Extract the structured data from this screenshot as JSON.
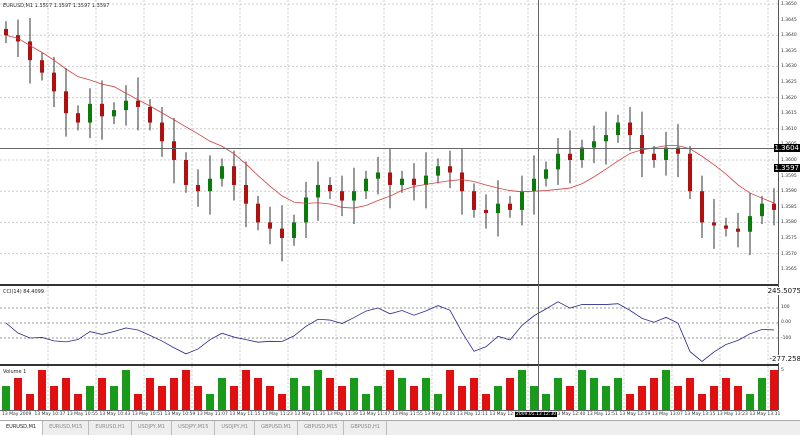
{
  "main": {
    "label": "EURUSD,M1  1.3597 1.3597 1.3597 1.3597",
    "crosshair_price": "1.3604",
    "current_price": "1.3597",
    "price_ticks": [
      "1.3650",
      "1.3645",
      "1.3640",
      "1.3635",
      "1.3630",
      "1.3625",
      "1.3620",
      "1.3615",
      "1.3610",
      "1.3605",
      "1.3600",
      "1.3595",
      "1.3590",
      "1.3585",
      "1.3580",
      "1.3575",
      "1.3570",
      "1.3565"
    ]
  },
  "osc": {
    "label": "CCI(14) 84.4099",
    "ticks": [
      "245.5075",
      "100",
      "0.00",
      "-100",
      "-277.258"
    ]
  },
  "vol": {
    "label": "Volume 1",
    "tick": "5"
  },
  "time": {
    "labels": [
      "13 May 2009",
      "13 May 10:37",
      "13 May 10:55",
      "13 May 10:43",
      "13 May 10:51",
      "13 May 10:59",
      "13 May 11:07",
      "13 May 11:15",
      "13 May 11:23",
      "13 May 11:31",
      "13 May 11:39",
      "13 May 11:47",
      "13 May 11:55",
      "13 May 12:03",
      "13 May 12:11",
      "13 May 12:15",
      "13 May 12:23",
      "13 May 12:40",
      "13 May 12:51",
      "13 May 12:59",
      "13 May 13:07",
      "13 May 13:15",
      "13 May 13:23",
      "13 May 13:31"
    ],
    "crosshair": "2009.05.13 12:30"
  },
  "tabs": [
    "EURUSD,M1",
    "EURUSD,M15",
    "EURUSD,H1",
    "USDJPY,M1",
    "USDJPY,M15",
    "USDJPY,H1",
    "GBPUSD,M1",
    "GBPUSD,M15",
    "GBPUSD,H1"
  ],
  "colors": {
    "up": "#0a7a0a",
    "down": "#b01010",
    "ma": "#d04040",
    "cci": "#2a2a8a"
  },
  "chart_data": {
    "type": "candlestick",
    "ylim": [
      1.3565,
      1.365
    ],
    "closes": [
      1.364,
      1.3638,
      1.3632,
      1.3628,
      1.3622,
      1.3615,
      1.3612,
      1.3618,
      1.3614,
      1.3616,
      1.3619,
      1.3617,
      1.3612,
      1.3606,
      1.36,
      1.3592,
      1.359,
      1.3594,
      1.3598,
      1.3592,
      1.3586,
      1.358,
      1.3578,
      1.3575,
      1.358,
      1.3588,
      1.3592,
      1.359,
      1.3587,
      1.359,
      1.3594,
      1.3596,
      1.3592,
      1.3594,
      1.3592,
      1.3595,
      1.3598,
      1.3596,
      1.359,
      1.3584,
      1.3583,
      1.3586,
      1.3584,
      1.359,
      1.3594,
      1.3597,
      1.3602,
      1.36,
      1.3604,
      1.3606,
      1.3608,
      1.3612,
      1.3608,
      1.3602,
      1.36,
      1.3604,
      1.3602,
      1.359,
      1.358,
      1.3579,
      1.3578,
      1.3577,
      1.3582,
      1.3586,
      1.3584
    ],
    "volumes": [
      3,
      4,
      2,
      5,
      3,
      4,
      2,
      3,
      4,
      3,
      5,
      2,
      4,
      3,
      4,
      5,
      3,
      2,
      4,
      3,
      5,
      4,
      3,
      2,
      4,
      3,
      5,
      4,
      3,
      4,
      2,
      3,
      5,
      4,
      3,
      4,
      2,
      5,
      3,
      4,
      2,
      3,
      4,
      5,
      3,
      2,
      4,
      3,
      5,
      4,
      3,
      4,
      2,
      3,
      4,
      5,
      3,
      4,
      2,
      3,
      4,
      3,
      2,
      4,
      5
    ]
  }
}
